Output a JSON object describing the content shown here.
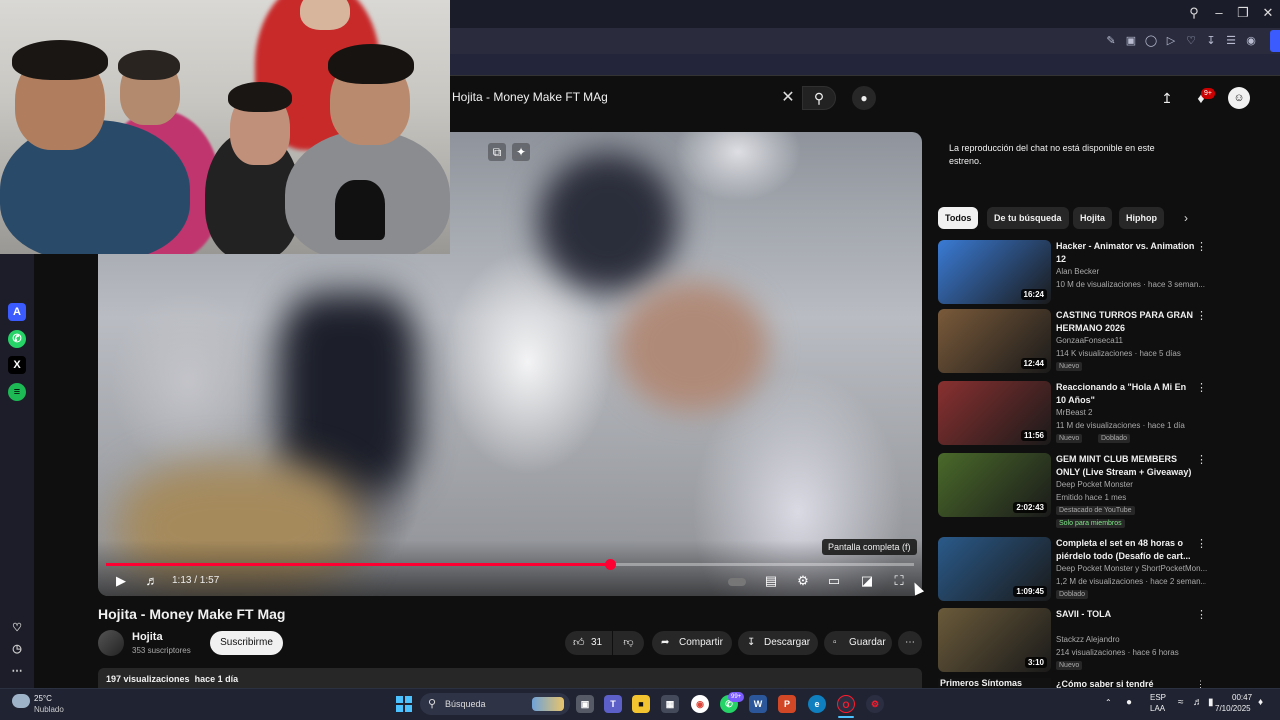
{
  "browser": {
    "window_controls": [
      "search-icon",
      "minimize-icon",
      "restore-icon",
      "close-icon"
    ]
  },
  "youtube": {
    "search": {
      "value": "Hojita - Money Make FT MAg"
    },
    "notifications_badge": "9+"
  },
  "player": {
    "time": "1:13 / 1:57",
    "progress": 0.624,
    "tooltip": "Pantalla completa (f)"
  },
  "video": {
    "title": "Hojita - Money Make FT Mag",
    "channel": {
      "name": "Hojita",
      "subscribers": "353 suscriptores",
      "subscribe_label": "Suscribirme"
    },
    "likes": "31",
    "share_label": "Compartir",
    "download_label": "Descargar",
    "save_label": "Guardar",
    "views": "197 visualizaciones",
    "date": "hace 1 día"
  },
  "chat": {
    "message": "La reproducción del chat no está disponible en este estreno."
  },
  "chips": [
    "Todos",
    "De tu búsqueda",
    "Hojita",
    "Hiphop"
  ],
  "recommendations": [
    {
      "title": "Hacker - Animator vs. Animation 12",
      "channel": "Alan Becker",
      "meta": "10 M de visualizaciones · hace 3 seman...",
      "duration": "16:24",
      "badges": [],
      "color": "#3a7bd5"
    },
    {
      "title": "CASTING TURROS PARA GRAN HERMANO 2026",
      "channel": "GonzaaFonseca11",
      "meta": "114 K visualizaciones · hace 5 días",
      "duration": "12:44",
      "badges": [
        "Nuevo"
      ],
      "color": "#7a5a3a"
    },
    {
      "title": "Reaccionando a \"Hola A Mi En 10 Años\"",
      "channel": "MrBeast 2",
      "meta": "11 M de visualizaciones · hace 1 día",
      "duration": "11:56",
      "badges": [
        "Nuevo",
        "Doblado"
      ],
      "color": "#8a3030"
    },
    {
      "title": "GEM MINT CLUB MEMBERS ONLY (Live Stream + Giveaway)",
      "channel": "Deep Pocket Monster",
      "meta": "Emitido hace 1 mes",
      "duration": "2:02:43",
      "badges": [
        "Destacado de YouTube"
      ],
      "extra": "Solo para miembros",
      "color": "#4a6a2a"
    },
    {
      "title": "Completa el set en 48 horas o piérdelo todo (Desafío de cart...",
      "channel": "Deep Pocket Monster y ShortPocketMon...",
      "meta": "1,2 M de visualizaciones · hace 2 seman...",
      "duration": "1:09:45",
      "badges": [
        "Doblado"
      ],
      "color": "#2a5a8a"
    },
    {
      "title": "SAVII - TOLA",
      "channel": "Stackzz Alejandro",
      "meta": "214 visualizaciones · hace 6 horas",
      "duration": "3:10",
      "badges": [
        "Nuevo"
      ],
      "color": "#6a5a3a"
    }
  ],
  "bottom_peek": {
    "left": "Primeros Síntomas",
    "right": "¿Cómo saber si tendré"
  },
  "taskbar": {
    "weather": {
      "temp": "25°C",
      "condition": "Nublado"
    },
    "search_placeholder": "Búsqueda",
    "whatsapp_badge": "99+",
    "lang": "ESP",
    "lang2": "LAA",
    "time": "00:47",
    "date": "7/10/2025"
  }
}
